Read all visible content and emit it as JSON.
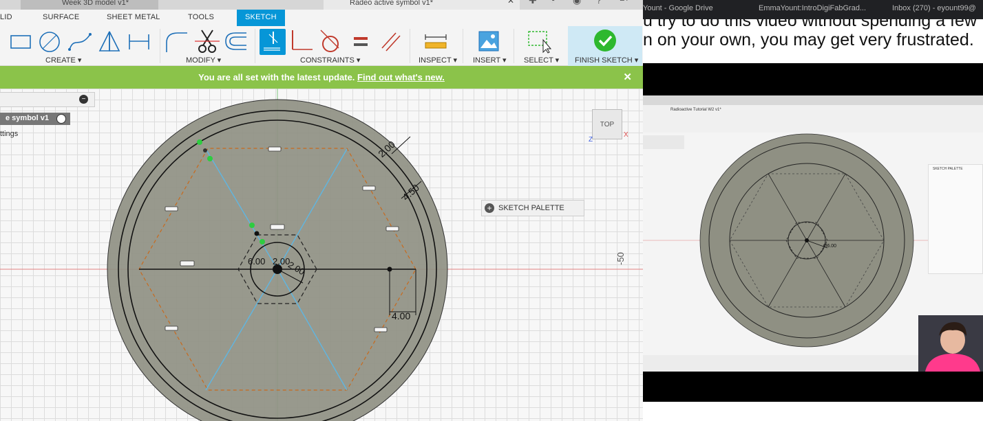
{
  "window": {
    "doc_tabs": [
      "Week 3D model v1*",
      "Radeo active symbol v1*"
    ],
    "user_initials": "ET"
  },
  "menu": {
    "tabs": [
      "LID",
      "SURFACE",
      "SHEET METAL",
      "TOOLS",
      "SKETCH"
    ],
    "active": "SKETCH"
  },
  "toolbar": {
    "groups": {
      "create": "CREATE ▾",
      "modify": "MODIFY ▾",
      "constraints": "CONSTRAINTS ▾",
      "inspect": "INSPECT ▾",
      "insert": "INSERT ▾",
      "select": "SELECT ▾",
      "finish": "FINISH SKETCH ▾"
    },
    "accent": "#0696d7",
    "finish_color": "#2eb82e"
  },
  "notice": {
    "text": "You are all set with the latest update.",
    "link": "Find out what's new.",
    "close": "✕",
    "color": "#8bc34a"
  },
  "browser": {
    "doc_label": "e symbol v1",
    "settings_label": "ttings"
  },
  "canvas": {
    "palette_label": "SKETCH PALETTE",
    "viewcube_label": "TOP",
    "dimensions": [
      "2.00",
      "4.50",
      "4.00",
      "6.00",
      "2.00",
      "2.00",
      "-50"
    ],
    "axis_x_label": "X",
    "axis_z_label": "Z"
  },
  "video": {
    "chrome_tabs": [
      "Yount - Google Drive",
      "EmmaYount:IntroDigiFabGrad...",
      "Inbox (270) - eyount99@"
    ],
    "caption_lines": [
      "u try to do this video without spending a few",
      "n on your own, you may get very frustrated."
    ],
    "inner_doc_tab": "Radioactive Tutorial W2 v1*",
    "inner_palette_title": "SKETCH PALETTE",
    "inner_dimension": "Ø6.00",
    "webcam_bg": "#ff3a8c"
  }
}
